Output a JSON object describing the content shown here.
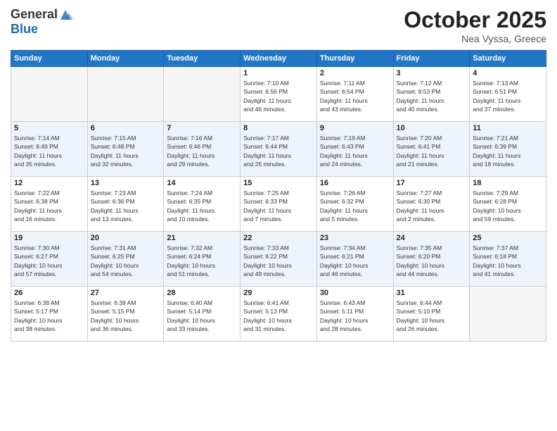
{
  "logo": {
    "line1": "General",
    "line2": "Blue"
  },
  "title": "October 2025",
  "location": "Nea Vyssa, Greece",
  "days_header": [
    "Sunday",
    "Monday",
    "Tuesday",
    "Wednesday",
    "Thursday",
    "Friday",
    "Saturday"
  ],
  "weeks": [
    {
      "days": [
        {
          "num": "",
          "info": ""
        },
        {
          "num": "",
          "info": ""
        },
        {
          "num": "",
          "info": ""
        },
        {
          "num": "1",
          "info": "Sunrise: 7:10 AM\nSunset: 6:56 PM\nDaylight: 11 hours\nand 46 minutes."
        },
        {
          "num": "2",
          "info": "Sunrise: 7:11 AM\nSunset: 6:54 PM\nDaylight: 11 hours\nand 43 minutes."
        },
        {
          "num": "3",
          "info": "Sunrise: 7:12 AM\nSunset: 6:53 PM\nDaylight: 11 hours\nand 40 minutes."
        },
        {
          "num": "4",
          "info": "Sunrise: 7:13 AM\nSunset: 6:51 PM\nDaylight: 11 hours\nand 37 minutes."
        }
      ]
    },
    {
      "days": [
        {
          "num": "5",
          "info": "Sunrise: 7:14 AM\nSunset: 6:49 PM\nDaylight: 11 hours\nand 35 minutes."
        },
        {
          "num": "6",
          "info": "Sunrise: 7:15 AM\nSunset: 6:48 PM\nDaylight: 11 hours\nand 32 minutes."
        },
        {
          "num": "7",
          "info": "Sunrise: 7:16 AM\nSunset: 6:46 PM\nDaylight: 11 hours\nand 29 minutes."
        },
        {
          "num": "8",
          "info": "Sunrise: 7:17 AM\nSunset: 6:44 PM\nDaylight: 11 hours\nand 26 minutes."
        },
        {
          "num": "9",
          "info": "Sunrise: 7:19 AM\nSunset: 6:43 PM\nDaylight: 11 hours\nand 24 minutes."
        },
        {
          "num": "10",
          "info": "Sunrise: 7:20 AM\nSunset: 6:41 PM\nDaylight: 11 hours\nand 21 minutes."
        },
        {
          "num": "11",
          "info": "Sunrise: 7:21 AM\nSunset: 6:39 PM\nDaylight: 11 hours\nand 18 minutes."
        }
      ]
    },
    {
      "days": [
        {
          "num": "12",
          "info": "Sunrise: 7:22 AM\nSunset: 6:38 PM\nDaylight: 11 hours\nand 16 minutes."
        },
        {
          "num": "13",
          "info": "Sunrise: 7:23 AM\nSunset: 6:36 PM\nDaylight: 11 hours\nand 13 minutes."
        },
        {
          "num": "14",
          "info": "Sunrise: 7:24 AM\nSunset: 6:35 PM\nDaylight: 11 hours\nand 10 minutes."
        },
        {
          "num": "15",
          "info": "Sunrise: 7:25 AM\nSunset: 6:33 PM\nDaylight: 11 hours\nand 7 minutes."
        },
        {
          "num": "16",
          "info": "Sunrise: 7:26 AM\nSunset: 6:32 PM\nDaylight: 11 hours\nand 5 minutes."
        },
        {
          "num": "17",
          "info": "Sunrise: 7:27 AM\nSunset: 6:30 PM\nDaylight: 11 hours\nand 2 minutes."
        },
        {
          "num": "18",
          "info": "Sunrise: 7:29 AM\nSunset: 6:28 PM\nDaylight: 10 hours\nand 59 minutes."
        }
      ]
    },
    {
      "days": [
        {
          "num": "19",
          "info": "Sunrise: 7:30 AM\nSunset: 6:27 PM\nDaylight: 10 hours\nand 57 minutes."
        },
        {
          "num": "20",
          "info": "Sunrise: 7:31 AM\nSunset: 6:25 PM\nDaylight: 10 hours\nand 54 minutes."
        },
        {
          "num": "21",
          "info": "Sunrise: 7:32 AM\nSunset: 6:24 PM\nDaylight: 10 hours\nand 51 minutes."
        },
        {
          "num": "22",
          "info": "Sunrise: 7:33 AM\nSunset: 6:22 PM\nDaylight: 10 hours\nand 49 minutes."
        },
        {
          "num": "23",
          "info": "Sunrise: 7:34 AM\nSunset: 6:21 PM\nDaylight: 10 hours\nand 46 minutes."
        },
        {
          "num": "24",
          "info": "Sunrise: 7:35 AM\nSunset: 6:20 PM\nDaylight: 10 hours\nand 44 minutes."
        },
        {
          "num": "25",
          "info": "Sunrise: 7:37 AM\nSunset: 6:18 PM\nDaylight: 10 hours\nand 41 minutes."
        }
      ]
    },
    {
      "days": [
        {
          "num": "26",
          "info": "Sunrise: 6:38 AM\nSunset: 5:17 PM\nDaylight: 10 hours\nand 38 minutes."
        },
        {
          "num": "27",
          "info": "Sunrise: 6:39 AM\nSunset: 5:15 PM\nDaylight: 10 hours\nand 36 minutes."
        },
        {
          "num": "28",
          "info": "Sunrise: 6:40 AM\nSunset: 5:14 PM\nDaylight: 10 hours\nand 33 minutes."
        },
        {
          "num": "29",
          "info": "Sunrise: 6:41 AM\nSunset: 5:13 PM\nDaylight: 10 hours\nand 31 minutes."
        },
        {
          "num": "30",
          "info": "Sunrise: 6:43 AM\nSunset: 5:11 PM\nDaylight: 10 hours\nand 28 minutes."
        },
        {
          "num": "31",
          "info": "Sunrise: 6:44 AM\nSunset: 5:10 PM\nDaylight: 10 hours\nand 26 minutes."
        },
        {
          "num": "",
          "info": ""
        }
      ]
    }
  ]
}
